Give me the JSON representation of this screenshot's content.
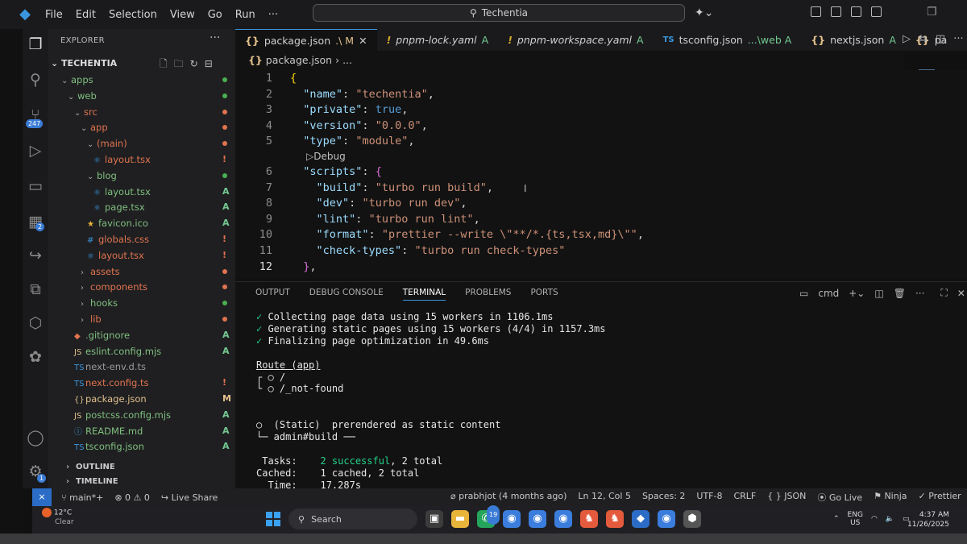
{
  "titlebar": {
    "menu": [
      "File",
      "Edit",
      "Selection",
      "View",
      "Go",
      "Run",
      "···"
    ],
    "search": "Techentia"
  },
  "activity_badges": {
    "source_control": "247",
    "extensions": "2",
    "accounts": "1"
  },
  "explorer": {
    "header": "EXPLORER",
    "project": "TECHENTIA",
    "items": [
      {
        "label": "apps",
        "kind": "folder",
        "open": true,
        "depth": 0,
        "mark": "dot",
        "mark_color": "#4caf50",
        "color": "#7fbf7f"
      },
      {
        "label": "web",
        "kind": "folder",
        "open": true,
        "depth": 1,
        "mark": "dot",
        "mark_color": "#4caf50",
        "color": "#7fbf7f"
      },
      {
        "label": "src",
        "kind": "folder",
        "open": true,
        "depth": 2,
        "mark": "dot",
        "mark_color": "#e0744f",
        "color": "#e0744f"
      },
      {
        "label": "app",
        "kind": "folder",
        "open": true,
        "depth": 3,
        "mark": "dot",
        "mark_color": "#e0744f",
        "color": "#e0744f"
      },
      {
        "label": "(main)",
        "kind": "folder",
        "open": true,
        "depth": 4,
        "mark": "dot",
        "mark_color": "#e0744f",
        "color": "#e0744f"
      },
      {
        "label": "layout.tsx",
        "kind": "tsx",
        "depth": 5,
        "mark": "!",
        "mark_color": "#e0744f",
        "color": "#e0744f"
      },
      {
        "label": "blog",
        "kind": "folder",
        "open": true,
        "depth": 4,
        "mark": "dot",
        "mark_color": "#4caf50",
        "color": "#7fbf7f"
      },
      {
        "label": "layout.tsx",
        "kind": "tsx",
        "depth": 5,
        "mark": "A",
        "mark_color": "#73c991",
        "color": "#7fbf7f"
      },
      {
        "label": "page.tsx",
        "kind": "tsx",
        "depth": 5,
        "mark": "A",
        "mark_color": "#73c991",
        "color": "#7fbf7f"
      },
      {
        "label": "favicon.ico",
        "kind": "star",
        "depth": 4,
        "mark": "A",
        "mark_color": "#73c991",
        "color": "#7fbf7f"
      },
      {
        "label": "globals.css",
        "kind": "css",
        "depth": 4,
        "mark": "!",
        "mark_color": "#e0744f",
        "color": "#e0744f"
      },
      {
        "label": "layout.tsx",
        "kind": "tsx",
        "depth": 4,
        "mark": "!",
        "mark_color": "#e0744f",
        "color": "#e0744f"
      },
      {
        "label": "assets",
        "kind": "folder",
        "open": false,
        "depth": 3,
        "mark": "dot",
        "mark_color": "#e0744f",
        "color": "#e0744f"
      },
      {
        "label": "components",
        "kind": "folder",
        "open": false,
        "depth": 3,
        "mark": "dot",
        "mark_color": "#e0744f",
        "color": "#e0744f"
      },
      {
        "label": "hooks",
        "kind": "folder",
        "open": false,
        "depth": 3,
        "mark": "dot",
        "mark_color": "#4caf50",
        "color": "#7fbf7f"
      },
      {
        "label": "lib",
        "kind": "folder",
        "open": false,
        "depth": 3,
        "mark": "dot",
        "mark_color": "#e0744f",
        "color": "#e0744f"
      },
      {
        "label": ".gitignore",
        "kind": "git",
        "depth": 2,
        "mark": "A",
        "mark_color": "#73c991",
        "color": "#7fbf7f"
      },
      {
        "label": "eslint.config.mjs",
        "kind": "js",
        "depth": 2,
        "mark": "A",
        "mark_color": "#73c991",
        "color": "#7fbf7f"
      },
      {
        "label": "next-env.d.ts",
        "kind": "ts",
        "depth": 2,
        "mark": "",
        "mark_color": "#73c991",
        "color": "#9a9a9a"
      },
      {
        "label": "next.config.ts",
        "kind": "ts",
        "depth": 2,
        "mark": "!",
        "mark_color": "#e0744f",
        "color": "#e0744f"
      },
      {
        "label": "package.json",
        "kind": "json",
        "depth": 2,
        "mark": "M",
        "mark_color": "#e2c08d",
        "color": "#e2c08d"
      },
      {
        "label": "postcss.config.mjs",
        "kind": "js",
        "depth": 2,
        "mark": "A",
        "mark_color": "#73c991",
        "color": "#7fbf7f"
      },
      {
        "label": "README.md",
        "kind": "md",
        "depth": 2,
        "mark": "A",
        "mark_color": "#73c991",
        "color": "#7fbf7f"
      },
      {
        "label": "tsconfig.json",
        "kind": "ts",
        "depth": 2,
        "mark": "A",
        "mark_color": "#73c991",
        "color": "#7fbf7f"
      }
    ],
    "outline": "OUTLINE",
    "timeline": "TIMELINE"
  },
  "tabs": [
    {
      "icon": "{}",
      "label": "package.json",
      "suffix": ".\\ M",
      "active": true
    },
    {
      "icon": "!",
      "label": "pnpm-lock.yaml",
      "suffix": "A"
    },
    {
      "icon": "!",
      "label": "pnpm-workspace.yaml",
      "suffix": "A"
    },
    {
      "icon": "TS",
      "label": "tsconfig.json",
      "suffix": "...\\web  A"
    },
    {
      "icon": "{}",
      "label": "nextjs.json",
      "suffix": "A"
    },
    {
      "icon": "{}",
      "label": "pa",
      "suffix": ""
    }
  ],
  "breadcrumb": {
    "file": "package.json",
    "rest": "› ..."
  },
  "editor": {
    "codelens": "Debug",
    "current_line": 12,
    "lines": [
      {
        "n": "1",
        "code": "{"
      },
      {
        "n": "2",
        "code": "  \"name\": \"techentia\","
      },
      {
        "n": "3",
        "code": "  \"private\": true,"
      },
      {
        "n": "4",
        "code": "  \"version\": \"0.0.0\","
      },
      {
        "n": "5",
        "code": "  \"type\": \"module\","
      },
      {
        "n": "6",
        "code": "  \"scripts\": {"
      },
      {
        "n": "7",
        "code": "    \"build\": \"turbo run build\","
      },
      {
        "n": "8",
        "code": "    \"dev\": \"turbo run dev\","
      },
      {
        "n": "9",
        "code": "    \"lint\": \"turbo run lint\","
      },
      {
        "n": "10",
        "code": "    \"format\": \"prettier --write \\\"**/*.{ts,tsx,md}\\\"\","
      },
      {
        "n": "11",
        "code": "    \"check-types\": \"turbo run check-types\""
      },
      {
        "n": "12",
        "code": "  },"
      }
    ]
  },
  "panel": {
    "tabs": [
      "OUTPUT",
      "DEBUG CONSOLE",
      "TERMINAL",
      "PROBLEMS",
      "PORTS"
    ],
    "active_tab": "TERMINAL",
    "shell": "cmd",
    "terminal": [
      "✓ Collecting page data using 15 workers in 1106.1ms",
      "✓ Generating static pages using 15 workers (4/4) in 1157.3ms",
      "✓ Finalizing page optimization in 49.6ms",
      "",
      "Route (app)",
      "┌ ○ /",
      "└ ○ /_not-found",
      "",
      "",
      "○  (Static)  prerendered as static content",
      "└─ admin#build ──",
      "",
      " Tasks:    2 successful, 2 total",
      "Cached:    1 cached, 2 total",
      "  Time:    17.287s"
    ]
  },
  "statusbar": {
    "branch": "main*+",
    "problems": "⊗ 0 ⚠ 0",
    "live_share": "Live Share",
    "blame": "prabhjot (4 months ago)",
    "position": "Ln 12, Col 5",
    "spaces": "Spaces: 2",
    "encoding": "UTF-8",
    "eol": "CRLF",
    "language": "{ } JSON",
    "golive": "Go Live",
    "ninja": "Ninja",
    "prettier": "Prettier"
  },
  "taskbar": {
    "temp": "12°C",
    "weather": "Clear",
    "search": "Search",
    "lang1": "ENG",
    "lang2": "US",
    "time": "4:37 AM",
    "date": "11/26/2025",
    "notif_badge": "19"
  }
}
